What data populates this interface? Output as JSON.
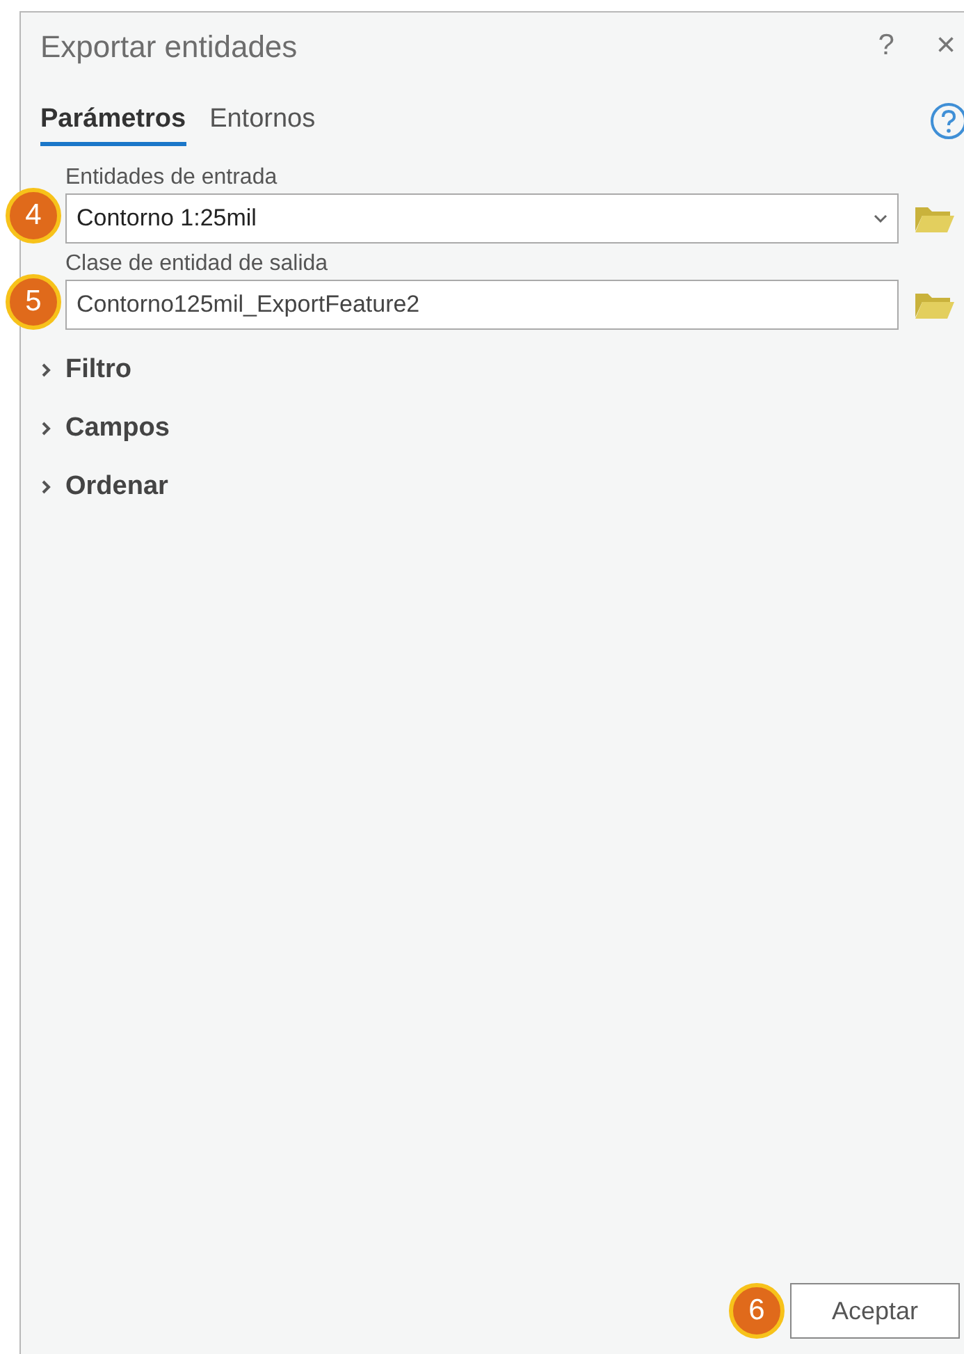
{
  "window": {
    "title": "Exportar entidades",
    "help": "?",
    "close": "×"
  },
  "tabs": [
    {
      "label": "Parámetros",
      "selected": true
    },
    {
      "label": "Entornos",
      "selected": false
    }
  ],
  "parameters": [
    {
      "label": "Entidades de entrada",
      "value": "Contorno 1:25mil",
      "kind": "dropdown",
      "callout": "4"
    },
    {
      "label": "Clase de entidad de salida",
      "value": "Contorno125mil_ExportFeature2",
      "kind": "text",
      "callout": "5"
    }
  ],
  "sections": [
    {
      "label": "Filtro",
      "expanded": false
    },
    {
      "label": "Campos",
      "expanded": false
    },
    {
      "label": "Ordenar",
      "expanded": false
    }
  ],
  "button": {
    "label": "Aceptar",
    "callout": "6"
  }
}
